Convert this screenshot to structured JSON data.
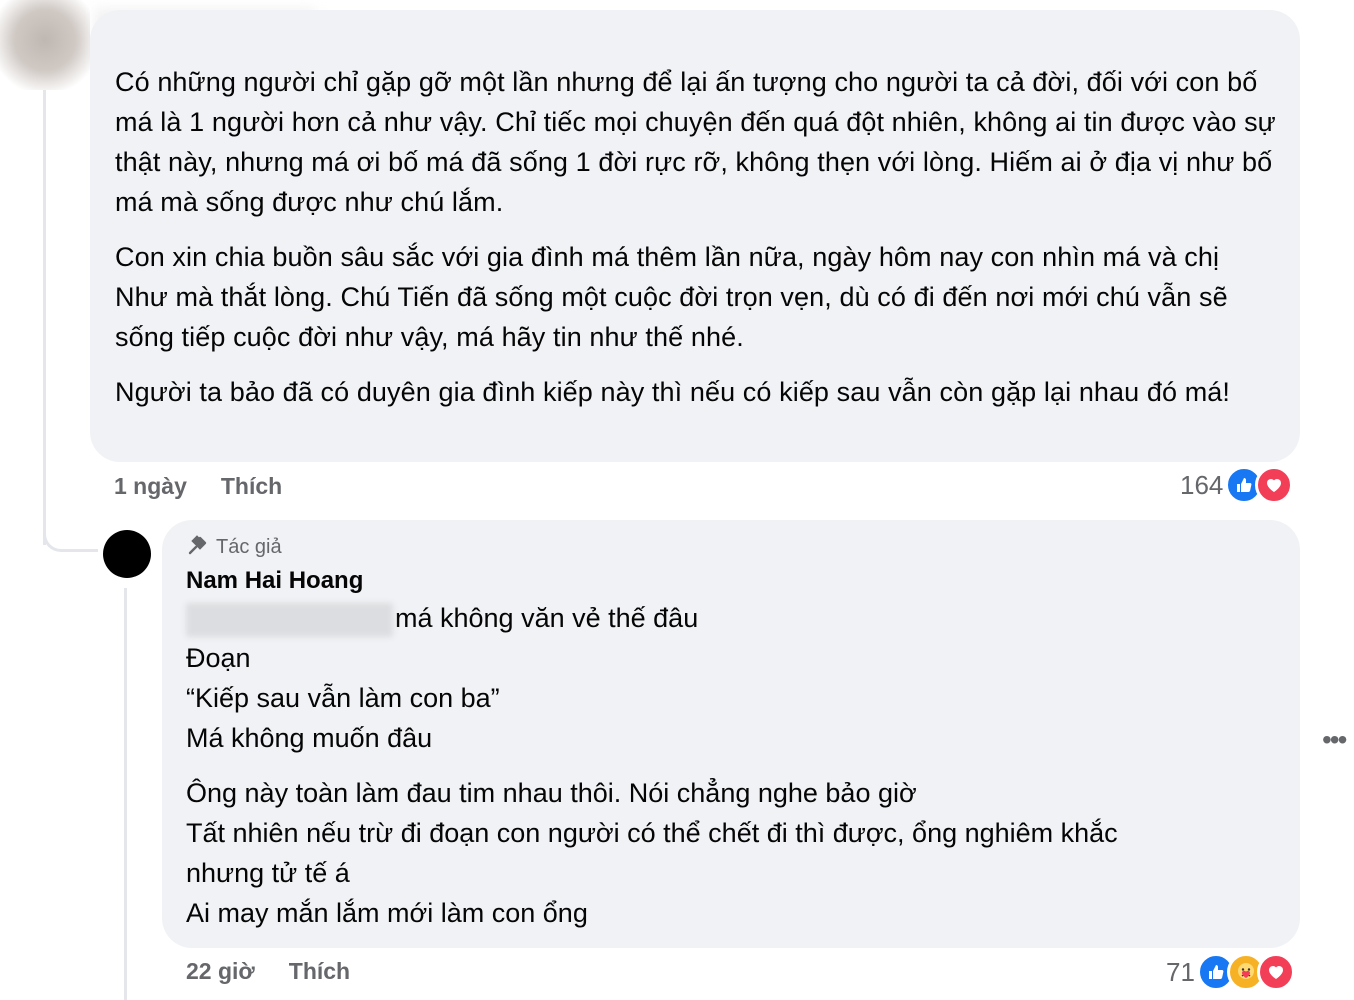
{
  "comment": {
    "paragraphs": [
      "Có những người chỉ gặp gỡ một lần nhưng để lại ấn tượng cho người ta cả đời, đối với con bố má là 1 người hơn cả như vậy. Chỉ tiếc mọi chuyện đến quá đột nhiên, không ai tin được vào sự thật này, nhưng má ơi bố má đã sống 1 đời rực rỡ, không thẹn với lòng. Hiếm ai ở địa vị như bố má mà sống được như chú lắm.",
      "Con xin chia buồn sâu sắc với gia đình má thêm lần nữa, ngày hôm nay con nhìn má và chị Như mà thắt lòng. Chú Tiến đã sống một cuộc đời trọn vẹn, dù có đi đến nơi mới chú vẫn sẽ sống tiếp cuộc đời như vậy, má hãy tin như thế nhé.",
      "Người ta bảo đã có duyên gia đình kiếp này thì nếu có kiếp sau vẫn còn gặp lại nhau đó má!"
    ],
    "time": "1 ngày",
    "like_label": "Thích",
    "reaction_count": "164"
  },
  "reply": {
    "badge": "Tác giả",
    "author": "Nam Hai Hoang",
    "lines": [
      "má không văn vẻ thế đâu",
      "Đoạn",
      "“Kiếp sau vẫn làm con ba”",
      "Má không muốn đâu",
      "Ông này toàn làm đau tim nhau thôi. Nói chẳng nghe bảo giờ",
      "Tất nhiên nếu trừ đi đoạn con người có thể chết đi thì được, ổng nghiêm khắc",
      "nhưng tử tế á",
      "Ai may mắn lắm mới làm con ổng"
    ],
    "time": "22 giờ",
    "like_label": "Thích",
    "reaction_count": "71"
  },
  "icons": {
    "badge_icon": "microphone-icon",
    "reactions_1": [
      "like-icon",
      "love-icon"
    ],
    "reactions_2": [
      "like-icon",
      "care-icon",
      "love-icon"
    ],
    "more": "more-options-icon"
  },
  "colors": {
    "bubble_bg": "#f0f2f5",
    "meta_text": "#65676b",
    "like_blue": "#1877f2",
    "love_red": "#f33e58",
    "care_yellow": "#f7b125"
  }
}
